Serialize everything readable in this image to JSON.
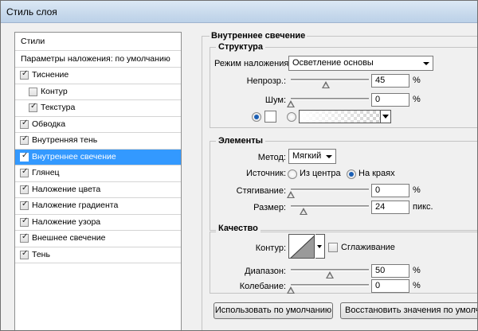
{
  "window": {
    "title": "Стиль слоя"
  },
  "styles_list": {
    "header": "Стили",
    "blending_options": "Параметры наложения: по умолчанию",
    "items": [
      {
        "label": "Тиснение",
        "checked": true
      },
      {
        "label": "Контур",
        "checked": false
      },
      {
        "label": "Текстура",
        "checked": true
      },
      {
        "label": "Обводка",
        "checked": true
      },
      {
        "label": "Внутренняя тень",
        "checked": true
      },
      {
        "label": "Внутреннее свечение",
        "checked": true,
        "selected": true
      },
      {
        "label": "Глянец",
        "checked": true
      },
      {
        "label": "Наложение цвета",
        "checked": true
      },
      {
        "label": "Наложение градиента",
        "checked": true
      },
      {
        "label": "Наложение узора",
        "checked": true
      },
      {
        "label": "Внешнее свечение",
        "checked": true
      },
      {
        "label": "Тень",
        "checked": true
      }
    ]
  },
  "panel": {
    "title": "Внутреннее свечение",
    "structure": {
      "title": "Структура",
      "blend_mode_label": "Режим наложения:",
      "blend_mode_value": "Осветление основы",
      "opacity_label": "Непрозр.:",
      "opacity_value": "45",
      "opacity_percent": 45,
      "noise_label": "Шум:",
      "noise_value": "0",
      "noise_percent": 0,
      "percent_unit": "%"
    },
    "elements": {
      "title": "Элементы",
      "method_label": "Метод:",
      "method_value": "Мягкий",
      "source_label": "Источник:",
      "source_center": "Из центра",
      "source_edge": "На краях",
      "source_selected": "edge",
      "choke_label": "Стягивание:",
      "choke_value": "0",
      "choke_percent": 0,
      "size_label": "Размер:",
      "size_value": "24",
      "size_unit": "пикс.",
      "percent_unit": "%"
    },
    "quality": {
      "title": "Качество",
      "contour_label": "Контур:",
      "antialias_label": "Сглаживание",
      "antialias_checked": false,
      "range_label": "Диапазон:",
      "range_value": "50",
      "range_percent": 50,
      "jitter_label": "Колебание:",
      "jitter_value": "0",
      "jitter_percent": 0,
      "percent_unit": "%"
    },
    "buttons": {
      "make_default": "Использовать по умолчанию",
      "reset_default": "Восстановить значения по умолчанию"
    }
  }
}
